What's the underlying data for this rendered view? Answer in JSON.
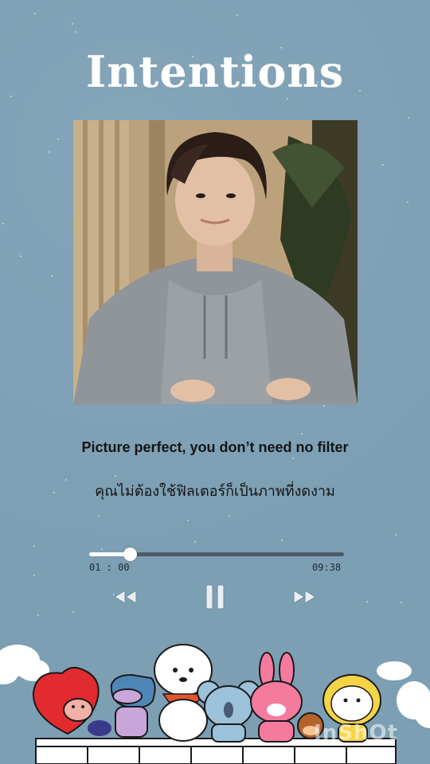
{
  "song": {
    "title": "Intentions"
  },
  "lyrics": {
    "english": "Picture perfect, you don’t need no filter",
    "thai": "คุณไม่ต้องใช้ฟิลเตอร์ก็เป็นภาพที่งดงาม"
  },
  "player": {
    "elapsed": "01 : 00",
    "total": "09:38",
    "progress_fraction": 0.16
  },
  "controls": {
    "rewind_icon": "rewind-icon",
    "pause_icon": "pause-icon",
    "forward_icon": "fast-forward-icon"
  },
  "watermark": {
    "text": "InShOt"
  },
  "colors": {
    "background": "#7d9fb4",
    "title": "#ffffff",
    "lyrics": "#141414",
    "track": "#4d5d69",
    "progress": "#ffffff",
    "controls": "#e8eef2"
  }
}
